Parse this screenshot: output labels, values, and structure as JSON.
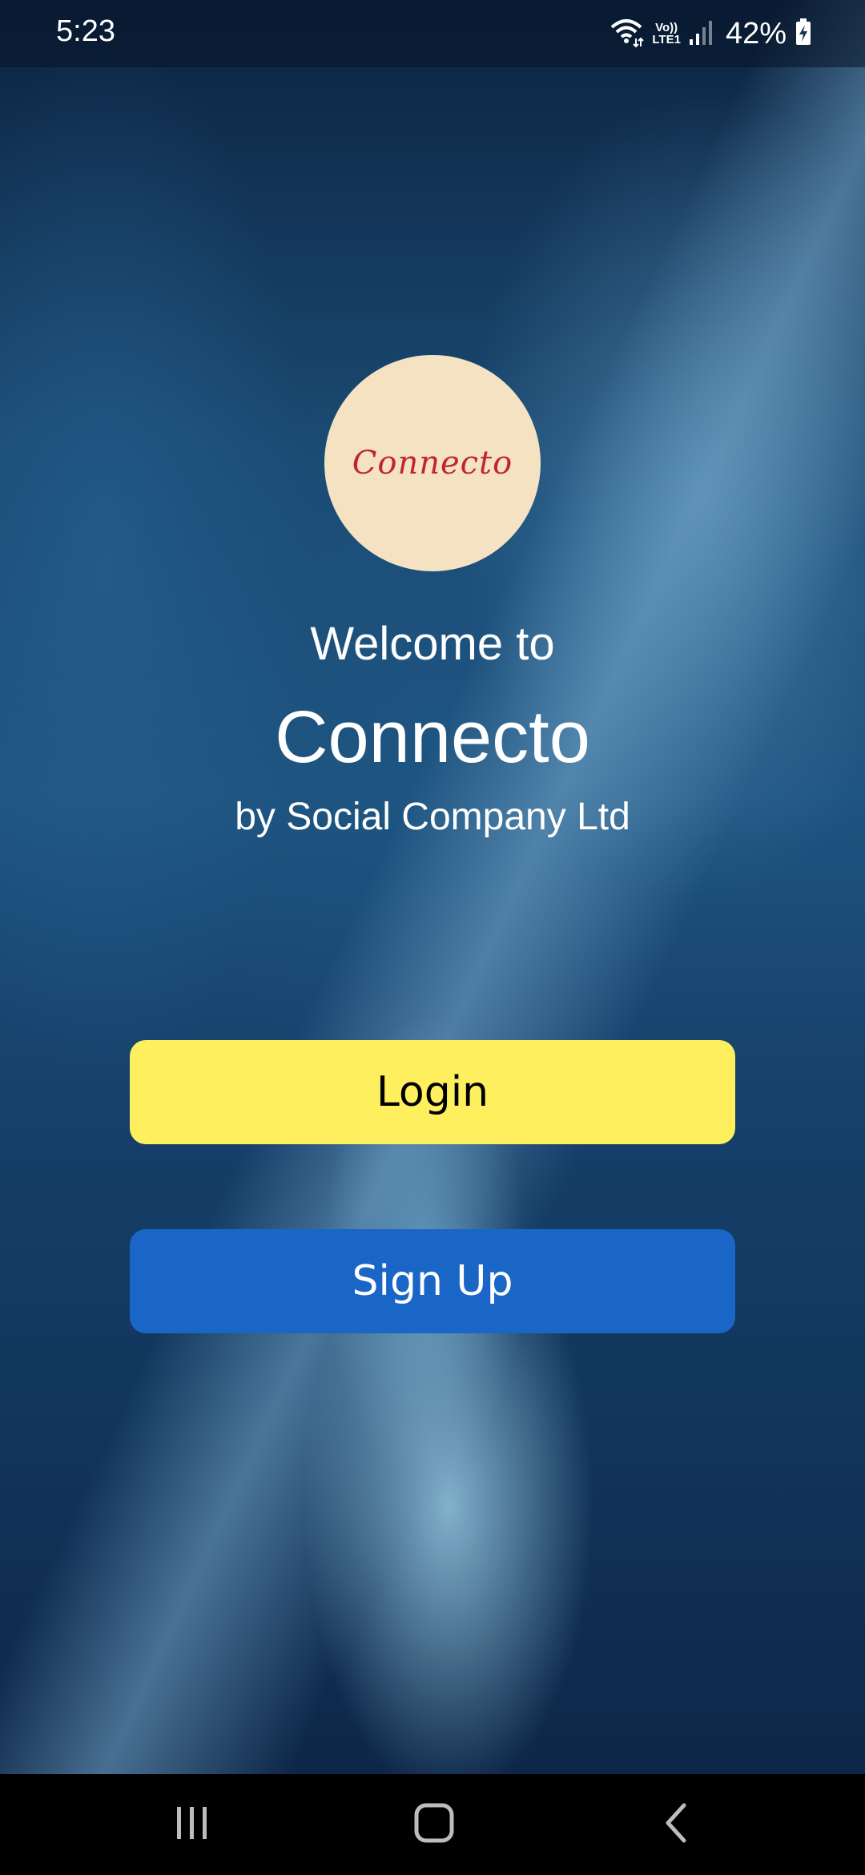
{
  "status_bar": {
    "time": "5:23",
    "network_label_top": "Vo))",
    "network_label_bottom": "LTE1",
    "battery": "42%",
    "icons": [
      "wifi-icon",
      "volte-lte-icon",
      "signal-icon",
      "battery-charging-icon"
    ]
  },
  "logo": {
    "text": "Connecto",
    "background_color": "#f4e2c3",
    "text_color": "#c0262d"
  },
  "welcome": {
    "line1": "Welcome to",
    "app_name": "Connecto",
    "by_line": "by Social Company Ltd"
  },
  "buttons": {
    "login_label": "Login",
    "signup_label": "Sign Up",
    "login_color": "#fdef5e",
    "signup_color": "#1a66c6"
  },
  "nav_bar": {
    "icons": [
      "recent-apps-icon",
      "home-icon",
      "back-icon"
    ]
  }
}
